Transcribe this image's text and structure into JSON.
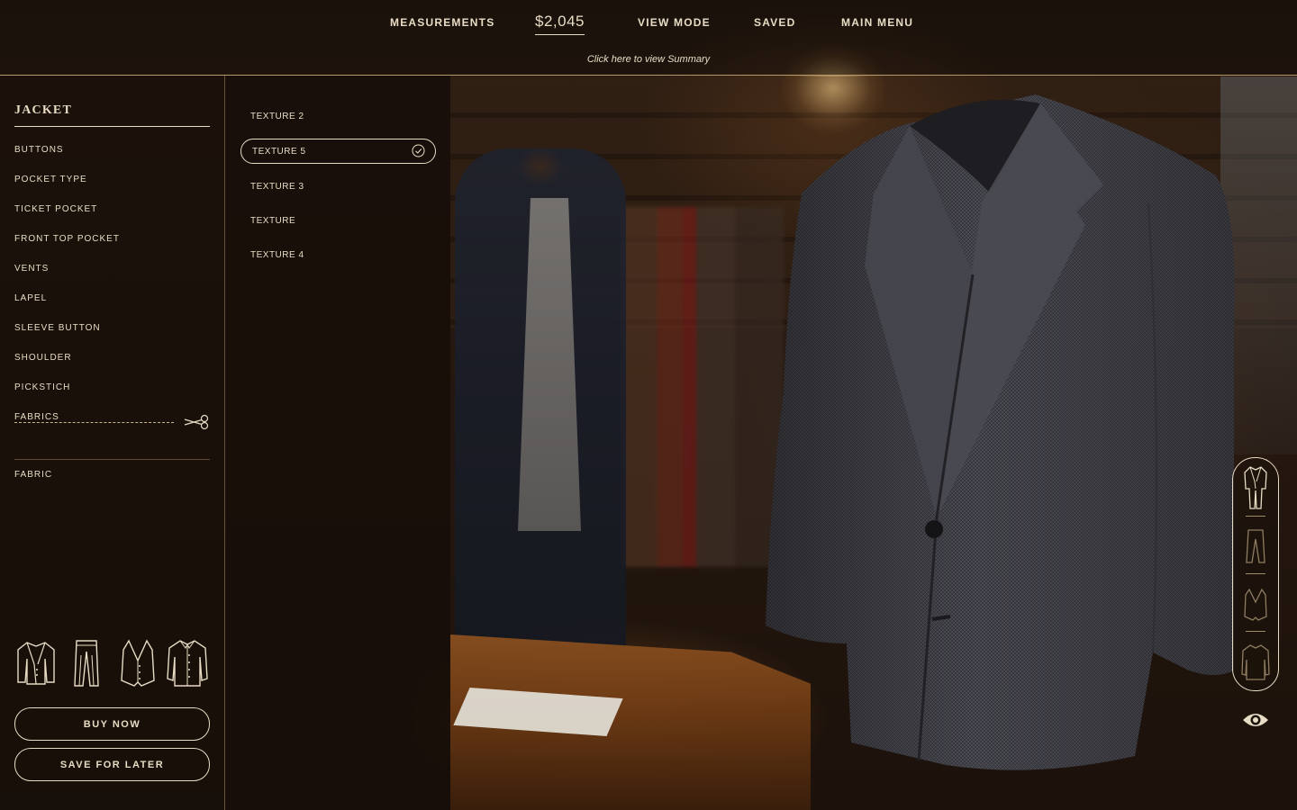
{
  "nav": {
    "measurements": "MEASUREMENTS",
    "price": "$2,045",
    "view_mode": "VIEW MODE",
    "saved": "SAVED",
    "main_menu": "MAIN MENU",
    "summary_link": "Click here to view Summary"
  },
  "sidebar": {
    "section_title": "JACKET",
    "items": [
      {
        "label": "BUTTONS"
      },
      {
        "label": "POCKET TYPE"
      },
      {
        "label": "TICKET POCKET"
      },
      {
        "label": "FRONT TOP POCKET"
      },
      {
        "label": "VENTS"
      },
      {
        "label": "LAPEL"
      },
      {
        "label": "SLEEVE BUTTON"
      },
      {
        "label": "SHOULDER"
      },
      {
        "label": "PICKSTICH"
      },
      {
        "label": "FABRICS"
      }
    ],
    "fabric_label": "FABRIC",
    "garments": [
      {
        "icon": "jacket-icon"
      },
      {
        "icon": "trousers-icon"
      },
      {
        "icon": "vest-icon"
      },
      {
        "icon": "shirt-icon"
      }
    ],
    "buy_now": "BUY NOW",
    "save_for_later": "SAVE FOR LATER"
  },
  "textures": {
    "items": [
      {
        "label": "TEXTURE 2"
      },
      {
        "label": "TEXTURE 5",
        "selected": true
      },
      {
        "label": "TEXTURE 3"
      },
      {
        "label": "TEXTURE"
      },
      {
        "label": "TEXTURE 4"
      }
    ]
  },
  "view_selector": {
    "items": [
      {
        "icon": "full-suit-icon",
        "active": true
      },
      {
        "icon": "trousers-icon"
      },
      {
        "icon": "vest-icon"
      },
      {
        "icon": "shirt-icon"
      }
    ],
    "toggle_icon": "eye-icon"
  },
  "colors": {
    "accent": "#e8dcc4",
    "panel": "#160e08",
    "fabric": "#3c3c42"
  }
}
